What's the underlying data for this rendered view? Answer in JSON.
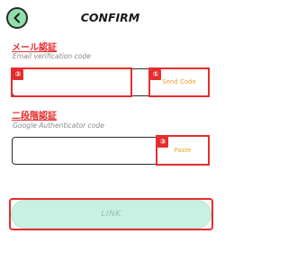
{
  "header": {
    "title": "CONFIRM",
    "back_icon": "chevron-left-icon"
  },
  "email_section": {
    "title": "メール認証",
    "subtitle": "Email verification code",
    "input_value": "",
    "button_label": "Send Code",
    "input_badge": "②",
    "button_badge": "①"
  },
  "google_section": {
    "title": "二段階認証",
    "subtitle": "Google Authenticator code",
    "input_value": "",
    "button_label": "Paste",
    "button_badge": "③"
  },
  "link_button": {
    "label": "LINK"
  },
  "colors": {
    "accent_red": "#e52d2d",
    "back_button_green": "#8ee0a9",
    "button_text_orange": "#f0a12a",
    "link_button_bg": "#c9f1e3"
  }
}
